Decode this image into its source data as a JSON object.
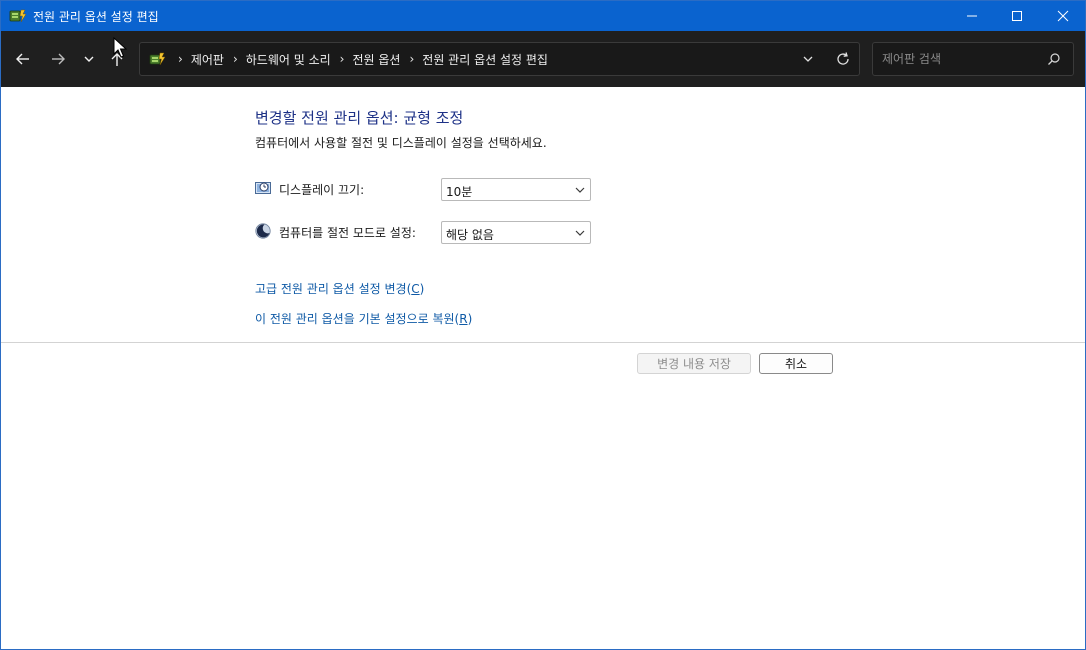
{
  "window": {
    "title": "전원 관리 옵션 설정 편집",
    "minimize_icon": "minimize-icon",
    "maximize_icon": "maximize-icon",
    "close_icon": "close-icon"
  },
  "navigation": {
    "back_icon": "arrow-left-icon",
    "forward_icon": "arrow-right-icon",
    "history_icon": "chevron-down-icon",
    "up_icon": "arrow-up-icon"
  },
  "address": {
    "breadcrumbs": [
      "제어판",
      "하드웨어 및 소리",
      "전원 옵션",
      "전원 관리 옵션 설정 편집"
    ],
    "dropdown_icon": "chevron-down-icon",
    "refresh_icon": "refresh-icon"
  },
  "search": {
    "placeholder": "제어판 검색",
    "value": ""
  },
  "main": {
    "title": "변경할 전원 관리 옵션: 균형 조정",
    "subtitle": "컴퓨터에서 사용할 절전 및 디스플레이 설정을 선택하세요.",
    "settings": [
      {
        "label": "디스플레이 끄기:",
        "value": "10분",
        "icon": "monitor-clock-icon"
      },
      {
        "label": "컴퓨터를 절전 모드로 설정:",
        "value": "해당 없음",
        "icon": "moon-icon"
      }
    ],
    "links": [
      {
        "text": "고급 전원 관리 옵션 설정 변경",
        "accel": "C"
      },
      {
        "text": "이 전원 관리 옵션을 기본 설정으로 복원",
        "accel": "R"
      }
    ],
    "buttons": {
      "save": "변경 내용 저장",
      "cancel": "취소"
    }
  },
  "colors": {
    "titlebar": "#0a63cf",
    "navbar": "#1f1f1f",
    "heading": "#1e3287",
    "link": "#0f5aa6"
  }
}
